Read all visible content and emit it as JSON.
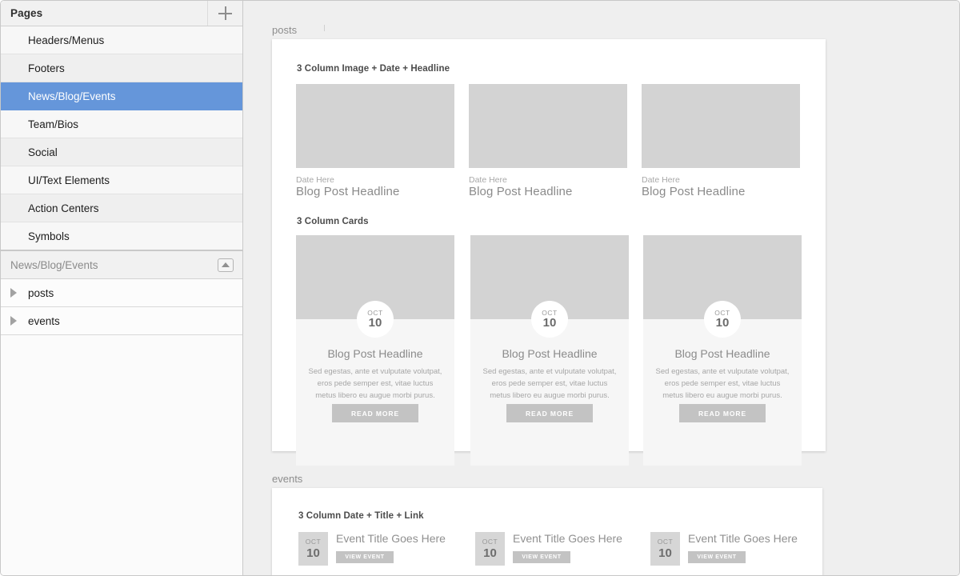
{
  "sidebar": {
    "header": {
      "title": "Pages",
      "add_icon": "plus-icon"
    },
    "pages": [
      {
        "label": "Headers/Menus"
      },
      {
        "label": "Footers"
      },
      {
        "label": "News/Blog/Events"
      },
      {
        "label": "Team/Bios"
      },
      {
        "label": "Social"
      },
      {
        "label": "UI/Text Elements"
      },
      {
        "label": "Action Centers"
      },
      {
        "label": "Symbols"
      }
    ],
    "selected_index": 2,
    "section": {
      "title": "News/Blog/Events",
      "collapse_icon": "collapse-up-icon",
      "rows": [
        {
          "label": "posts",
          "disclosure_icon": "triangle-right-icon"
        },
        {
          "label": "events",
          "disclosure_icon": "triangle-right-icon"
        }
      ]
    }
  },
  "canvas": {
    "artboards": [
      {
        "label": "posts"
      },
      {
        "label": "events"
      }
    ],
    "posts": {
      "section1": {
        "heading": "3 Column Image + Date + Headline",
        "columns": [
          {
            "date": "Date Here",
            "headline": "Blog Post Headline",
            "image": "image-placeholder"
          },
          {
            "date": "Date Here",
            "headline": "Blog Post Headline",
            "image": "image-placeholder"
          },
          {
            "date": "Date Here",
            "headline": "Blog Post Headline",
            "image": "image-placeholder"
          }
        ]
      },
      "section2": {
        "heading": "3 Column Cards",
        "cards": [
          {
            "month": "OCT",
            "day": "10",
            "title": "Blog Post Headline",
            "body": "Sed egestas, ante et vulputate volutpat, eros pede semper est, vitae luctus metus libero eu augue morbi purus.",
            "button": "READ MORE"
          },
          {
            "month": "OCT",
            "day": "10",
            "title": "Blog Post Headline",
            "body": "Sed egestas, ante et vulputate volutpat, eros pede semper est, vitae luctus metus libero eu augue morbi purus.",
            "button": "READ MORE"
          },
          {
            "month": "OCT",
            "day": "10",
            "title": "Blog Post Headline",
            "body": "Sed egestas, ante et vulputate volutpat, eros pede semper est, vitae luctus metus libero eu augue morbi purus.",
            "button": "READ MORE"
          }
        ]
      }
    },
    "events": {
      "section1": {
        "heading": "3 Column Date + Title + Link",
        "items": [
          {
            "month": "OCT",
            "day": "10",
            "title": "Event Title Goes Here",
            "button": "VIEW EVENT"
          },
          {
            "month": "OCT",
            "day": "10",
            "title": "Event Title Goes Here",
            "button": "VIEW EVENT"
          },
          {
            "month": "OCT",
            "day": "10",
            "title": "Event Title Goes Here",
            "button": "VIEW EVENT"
          }
        ]
      }
    }
  },
  "colors": {
    "selection": "#6596da",
    "canvas": "#efefef",
    "placeholder": "#d3d3d3",
    "button": "#c3c3c3"
  }
}
